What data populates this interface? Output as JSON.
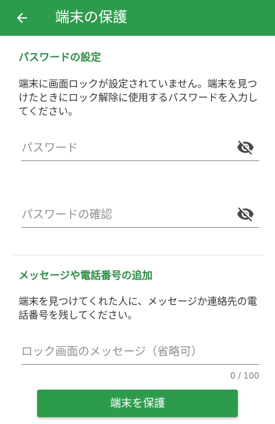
{
  "appbar": {
    "title": "端末の保護",
    "back_icon": "arrow-back-icon"
  },
  "password_section": {
    "title": "パスワードの設定",
    "description": "端末に画面ロックが設定されていません。端末を見つけたときにロック解除に使用するパスワードを入力してください。",
    "password_field": {
      "placeholder": "パスワード",
      "value": "",
      "toggle_icon": "eye-off-icon"
    },
    "confirm_field": {
      "placeholder": "パスワードの確認",
      "value": "",
      "toggle_icon": "eye-off-icon"
    }
  },
  "message_section": {
    "title": "メッセージや電話番号の追加",
    "description": "端末を見つけてくれた人に、メッセージか連絡先の電話番号を残してください。",
    "message_field": {
      "placeholder": "ロック画面のメッセージ（省略可）",
      "value": ""
    },
    "counter": "0 / 100"
  },
  "primary_button": {
    "label": "端末を保護"
  },
  "colors": {
    "primary": "#2c9c4c",
    "section_title": "#2c8a44"
  }
}
